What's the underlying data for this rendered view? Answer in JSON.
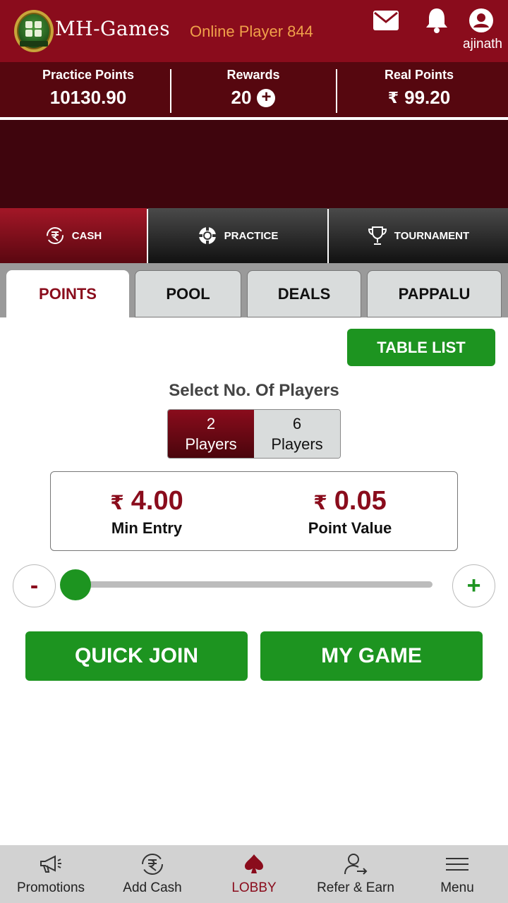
{
  "header": {
    "brand": "MH-Games",
    "online_text": "Online Player 844",
    "username": "ajinath",
    "icons": [
      "mail-icon",
      "bell-icon",
      "user-icon"
    ]
  },
  "points": {
    "practice_label": "Practice Points",
    "practice_value": "10130.90",
    "rewards_label": "Rewards",
    "rewards_value": "20",
    "real_label": "Real Points",
    "real_currency": "₹",
    "real_value": "99.20"
  },
  "modes": [
    {
      "label": "CASH",
      "icon": "rupee-cycle-icon",
      "active": true
    },
    {
      "label": "PRACTICE",
      "icon": "chip-icon",
      "active": false
    },
    {
      "label": "TOURNAMENT",
      "icon": "trophy-icon",
      "active": false
    }
  ],
  "sub_tabs": [
    {
      "label": "POINTS",
      "active": true
    },
    {
      "label": "POOL",
      "active": false
    },
    {
      "label": "DEALS",
      "active": false
    },
    {
      "label": "PAPPALU",
      "active": false
    }
  ],
  "table_list_label": "TABLE LIST",
  "select_players": {
    "title": "Select No. Of Players",
    "options": [
      {
        "num": "2",
        "word": "Players",
        "active": true
      },
      {
        "num": "6",
        "word": "Players",
        "active": false
      }
    ]
  },
  "entry": {
    "currency": "₹",
    "min_entry_value": "4.00",
    "min_entry_label": "Min Entry",
    "point_value": "0.05",
    "point_value_label": "Point Value"
  },
  "stepper": {
    "minus": "-",
    "plus": "+",
    "slider_fraction": 0.0
  },
  "actions": {
    "quick_join": "QUICK JOIN",
    "my_game": "MY GAME"
  },
  "bottom_nav": [
    {
      "label": "Promotions",
      "icon": "megaphone-icon",
      "active": false
    },
    {
      "label": "Add Cash",
      "icon": "rupee-cycle-icon",
      "active": false
    },
    {
      "label": "LOBBY",
      "icon": "spade-icon",
      "active": true
    },
    {
      "label": "Refer & Earn",
      "icon": "refer-user-icon",
      "active": false
    },
    {
      "label": "Menu",
      "icon": "hamburger-icon",
      "active": false
    }
  ],
  "colors": {
    "header": "#8a0c1c",
    "points_bar": "#56070f",
    "accent_green": "#1d9420",
    "online_text": "#f0a14a"
  }
}
